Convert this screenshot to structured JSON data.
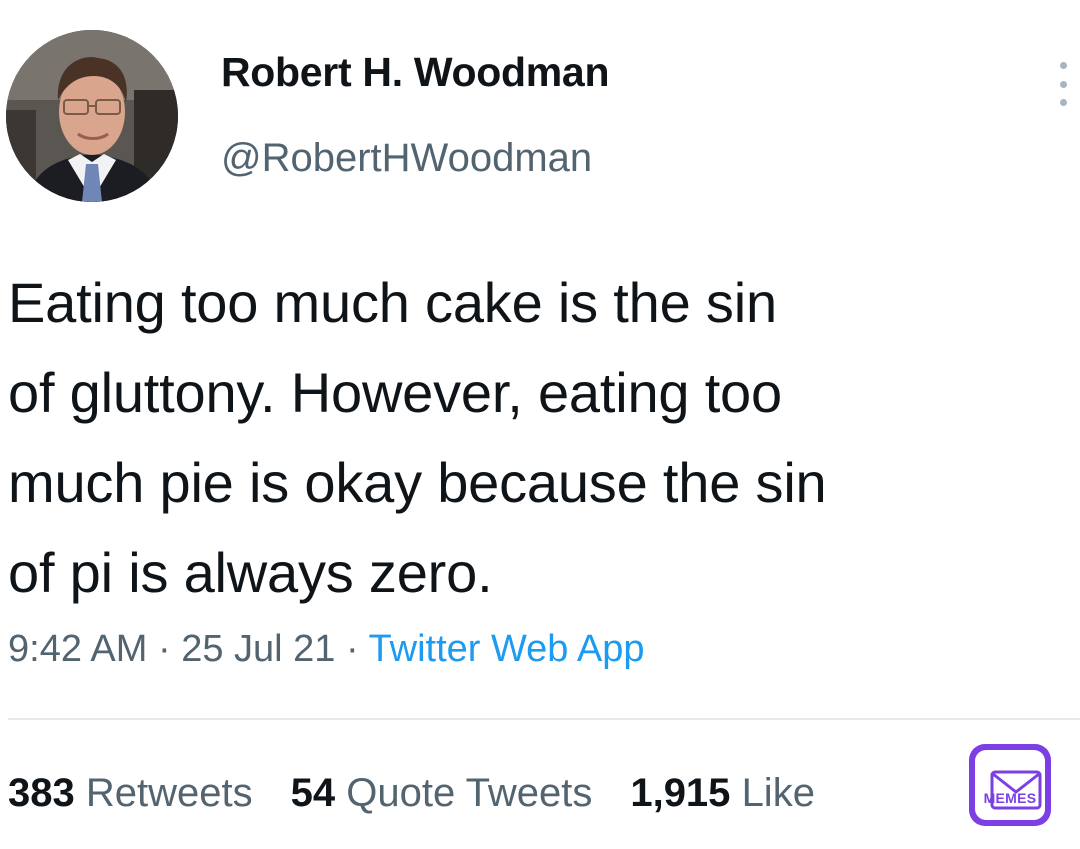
{
  "author": {
    "display_name": "Robert H. Woodman",
    "handle": "@RobertHWoodman"
  },
  "tweet": {
    "text": "Eating too much cake is the sin\nof gluttony. However, eating too\nmuch pie is okay because the sin\nof pi is always zero.",
    "time": "9:42 AM",
    "date": "25 Jul 21",
    "separator": "·",
    "source": "Twitter Web App"
  },
  "stats": {
    "retweets_count": "383",
    "retweets_label": "Retweets",
    "quote_tweets_count": "54",
    "quote_tweets_label": "Quote Tweets",
    "likes_count": "1,915",
    "likes_label": "Like"
  },
  "watermark": {
    "text": "MEMES"
  },
  "icons": {
    "more": "more-options-icon",
    "avatar": "profile-photo",
    "watermark": "memes-logo-icon"
  },
  "colors": {
    "text": "#0f1419",
    "secondary": "#536471",
    "link": "#1d9bf0",
    "watermark": "#7b3fe4"
  }
}
